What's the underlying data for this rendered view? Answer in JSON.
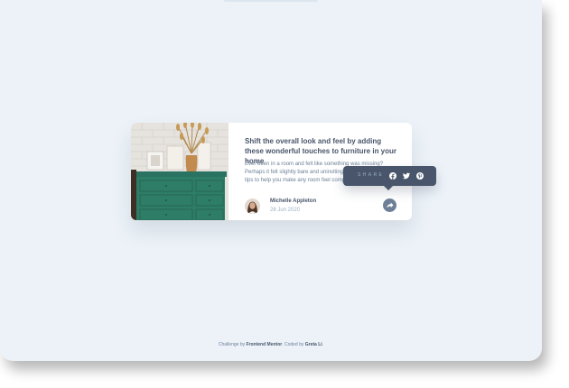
{
  "article": {
    "title": "Shift the overall look and feel by adding these wonderful touches to furniture in your home",
    "excerpt": "Ever been in a room and felt like something was missing? Perhaps it felt slightly bare and uninviting. I've got some simple tips to help you make any room feel complete."
  },
  "author": {
    "name": "Michelle Appleton",
    "date": "28 Jun 2020"
  },
  "share": {
    "label": "SHARE",
    "networks": [
      "facebook-icon",
      "twitter-icon",
      "pinterest-icon"
    ]
  },
  "attribution": {
    "prefix": "Challenge by",
    "platform": "Frontend Mentor",
    "middle": ". Coded by",
    "coder": "Greta Li",
    "suffix": "."
  },
  "colors": {
    "page_bg": "#ecf2f8",
    "heading": "#48556a",
    "body_text": "#6e8098",
    "muted": "#9eafc2",
    "popup_bg": "#48556a",
    "dresser": "#2e7d66"
  }
}
